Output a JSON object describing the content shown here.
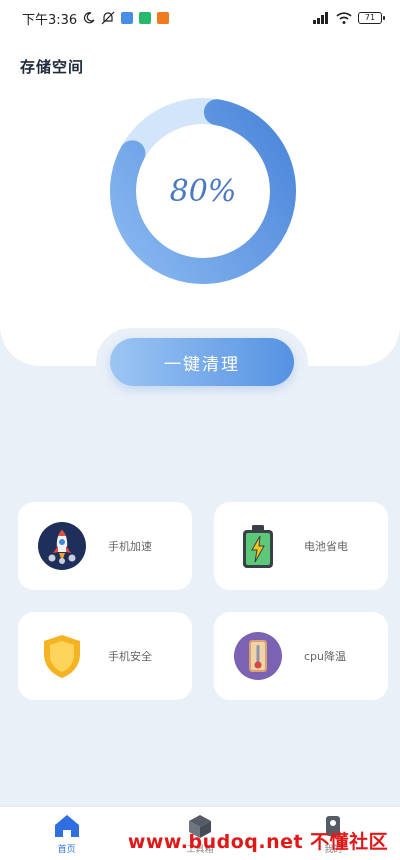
{
  "status_bar": {
    "time": "下午3:36",
    "battery_level": "71",
    "app_icon_colors": [
      "#4a8de8",
      "#27b86a",
      "#f07b1f"
    ]
  },
  "storage": {
    "title": "存储空间",
    "usage_text": "80%",
    "usage_value": 0.8,
    "ring_colors": {
      "used": "#5f98e3",
      "free": "#d3e5fb"
    }
  },
  "clean_button": {
    "label": "一键清理"
  },
  "tools": [
    {
      "label": "手机加速",
      "icon": "rocket-icon"
    },
    {
      "label": "电池省电",
      "icon": "battery-charging-icon"
    },
    {
      "label": "手机安全",
      "icon": "shield-icon"
    },
    {
      "label": "cpu降温",
      "icon": "thermometer-icon"
    }
  ],
  "tabbar": {
    "items": [
      {
        "label": "首页",
        "icon": "home-icon",
        "active": true
      },
      {
        "label": "工具箱",
        "icon": "toolbox-icon",
        "active": false
      },
      {
        "label": "我的",
        "icon": "user-icon",
        "active": false
      }
    ]
  },
  "watermark": {
    "text": "www.budoq.net 不懂社区"
  }
}
